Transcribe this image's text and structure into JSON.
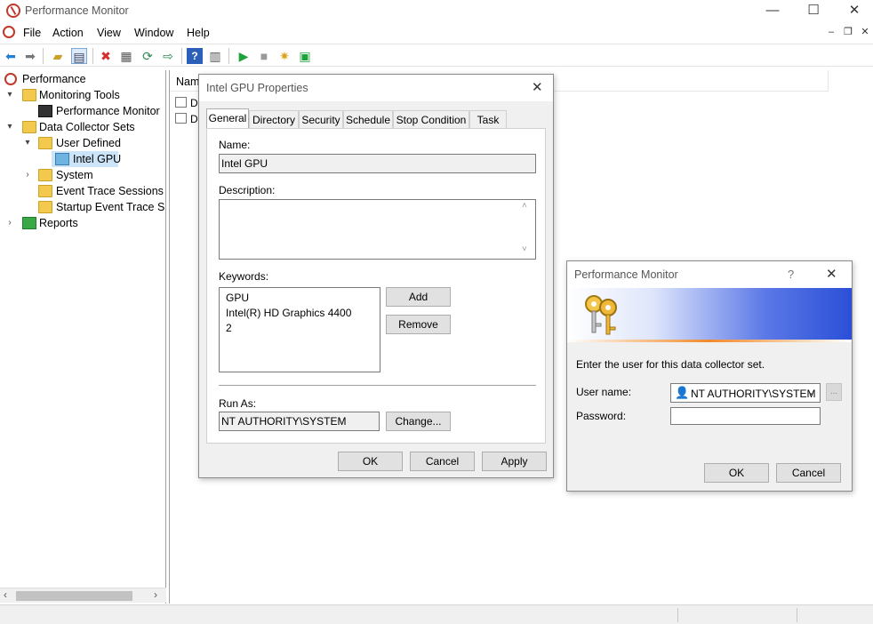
{
  "app": {
    "title": "Performance Monitor"
  },
  "menu": {
    "items": [
      "File",
      "Action",
      "View",
      "Window",
      "Help"
    ]
  },
  "toolbar": {
    "icons": [
      "back-arrow-icon",
      "forward-arrow-icon",
      "folder-up-icon",
      "show-hide-tree-icon",
      "delete-icon",
      "properties-icon",
      "refresh-icon",
      "export-list-icon",
      "help-icon",
      "show-action-pane-icon",
      "start-icon",
      "stop-icon",
      "new-icon",
      "save-icon"
    ]
  },
  "tree": {
    "nodes": [
      {
        "label": "Performance"
      },
      {
        "label": "Monitoring Tools"
      },
      {
        "label": "Performance Monitor"
      },
      {
        "label": "Data Collector Sets"
      },
      {
        "label": "User Defined"
      },
      {
        "label": "Intel GPU"
      },
      {
        "label": "System"
      },
      {
        "label": "Event Trace Sessions"
      },
      {
        "label": "Startup Event Trace Sess"
      },
      {
        "label": "Reports"
      }
    ]
  },
  "list": {
    "column_name": "Nam",
    "rows": [
      "Da",
      "Da"
    ]
  },
  "props_dialog": {
    "title": "Intel GPU Properties",
    "tabs": [
      "General",
      "Directory",
      "Security",
      "Schedule",
      "Stop Condition",
      "Task"
    ],
    "name_label": "Name:",
    "name_value": "Intel GPU",
    "description_label": "Description:",
    "description_value": "",
    "keywords_label": "Keywords:",
    "keywords": [
      "GPU",
      "Intel(R) HD Graphics 4400",
      "2"
    ],
    "add_label": "Add",
    "remove_label": "Remove",
    "runas_label": "Run As:",
    "runas_value": "NT AUTHORITY\\SYSTEM",
    "change_label": "Change...",
    "ok_label": "OK",
    "cancel_label": "Cancel",
    "apply_label": "Apply"
  },
  "user_dialog": {
    "title": "Performance Monitor",
    "help_glyph": "?",
    "prompt": "Enter the user for this data collector set.",
    "username_label": "User name:",
    "username_value": "NT AUTHORITY\\SYSTEM",
    "browse_label": "...",
    "password_label": "Password:",
    "password_value": "",
    "ok_label": "OK",
    "cancel_label": "Cancel"
  }
}
